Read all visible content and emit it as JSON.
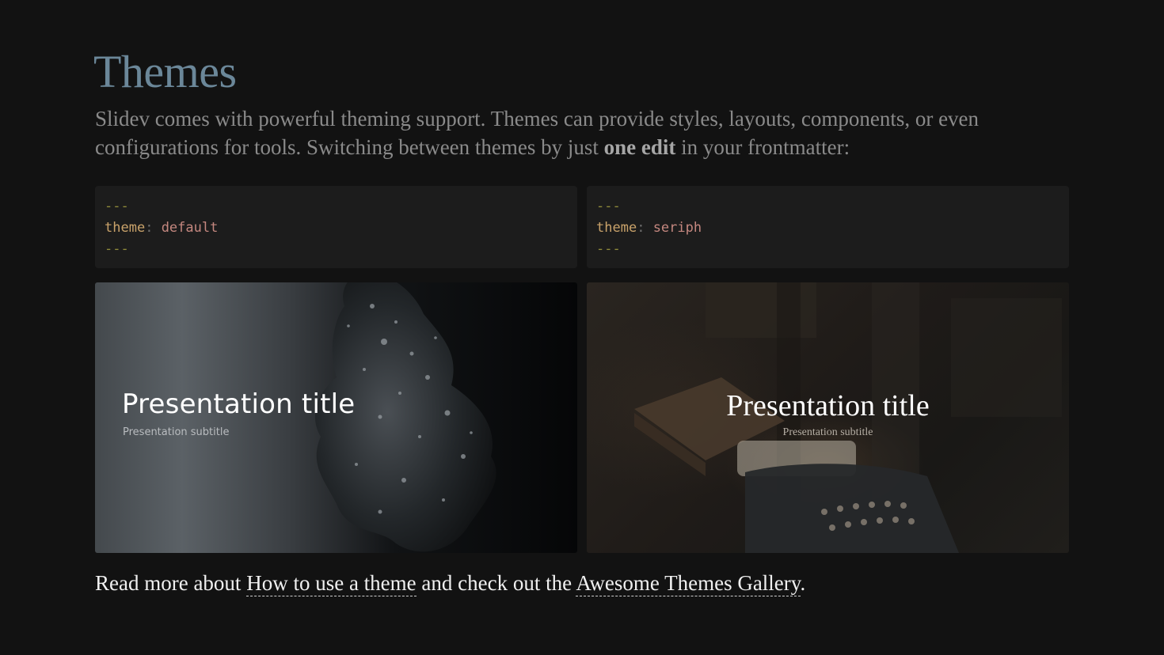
{
  "slide": {
    "title": "Themes",
    "intro_part1": "Slidev comes with powerful theming support. Themes can provide styles, layouts, components, or even configurations for tools. Switching between themes by just ",
    "intro_bold": "one edit",
    "intro_part2": " in your frontmatter:"
  },
  "code_blocks": [
    {
      "dash_open": "---",
      "key": "theme",
      "colon": ":",
      "value": "default",
      "dash_close": "---"
    },
    {
      "dash_open": "---",
      "key": "theme",
      "colon": ":",
      "value": "seriph",
      "dash_close": "---"
    }
  ],
  "previews": [
    {
      "title": "Presentation title",
      "subtitle": "Presentation subtitle"
    },
    {
      "title": "Presentation title",
      "subtitle": "Presentation subtitle"
    }
  ],
  "footer": {
    "text1": "Read more about ",
    "link1": "How to use a theme",
    "text2": " and check out the ",
    "link2": "Awesome Themes Gallery",
    "text3": "."
  },
  "colors": {
    "background": "#121212",
    "title": "#6b8799",
    "code_bg": "#1c1c1c"
  }
}
